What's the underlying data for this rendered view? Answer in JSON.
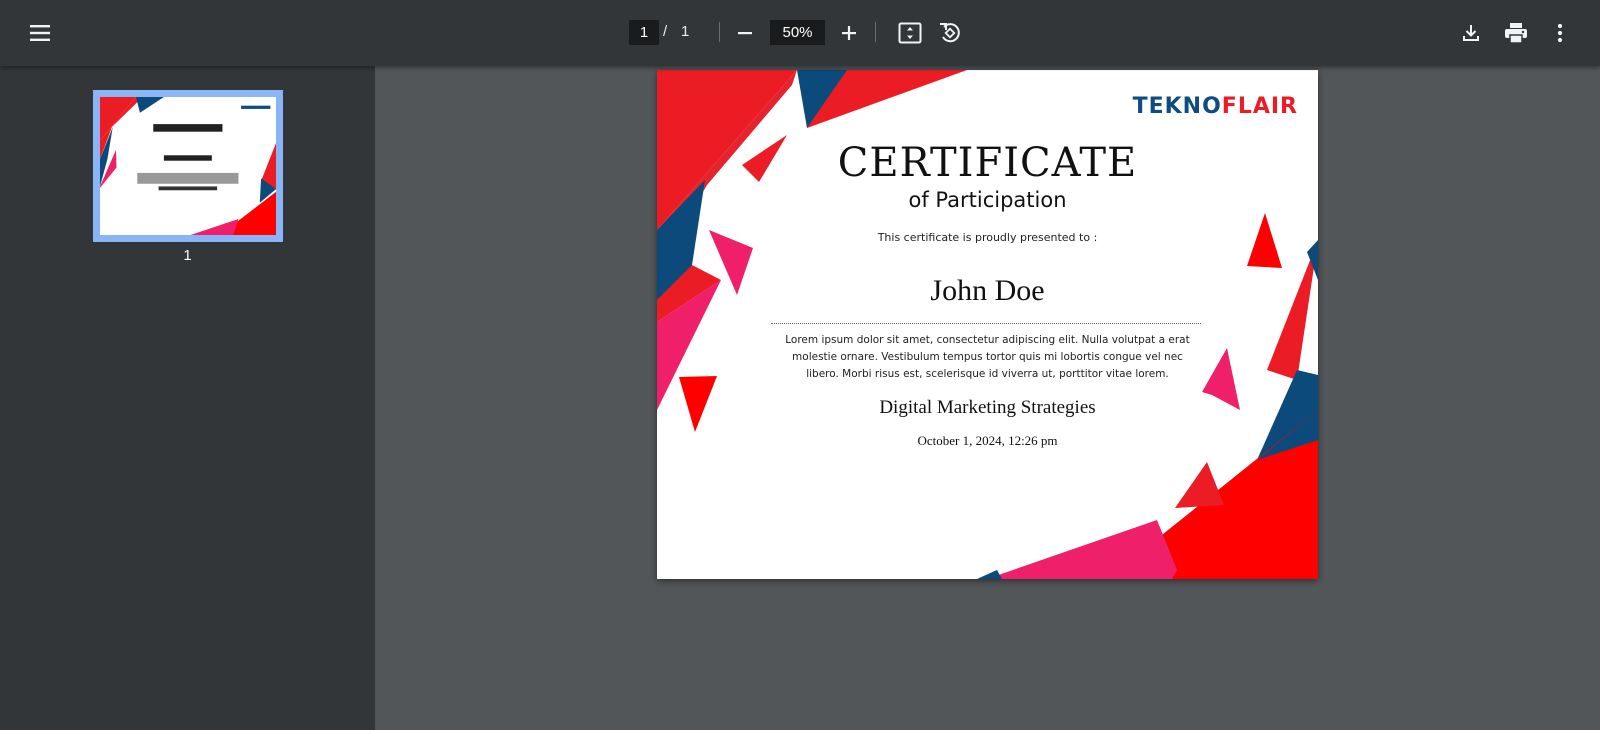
{
  "toolbar": {
    "current_page": "1",
    "page_separator": "/",
    "total_pages": "1",
    "zoom": "50%"
  },
  "icons": [
    "menu-icon",
    "zoom-out-icon",
    "zoom-in-icon",
    "fit-page-icon",
    "rotate-icon",
    "download-icon",
    "print-icon",
    "more-vert-icon"
  ],
  "sidebar": {
    "thumbnails": [
      {
        "page_label": "1"
      }
    ]
  },
  "certificate": {
    "logo_part1": "TEKNO",
    "logo_part2": "FLAIR",
    "title": "CERTIFICATE",
    "subtitle": "of Participation",
    "presented_to": "This certificate is proudly presented to :",
    "recipient": "John Doe",
    "body": "Lorem ipsum dolor sit amet, consectetur adipiscing elit. Nulla volutpat a erat molestie ornare. Vestibulum tempus tortor quis mi lobortis congue vel nec libero. Morbi risus est, scelerisque id viverra ut, porttitor vitae lorem.",
    "course": "Digital Marketing Strategies",
    "date": "October 1, 2024, 12:26 pm"
  },
  "colors": {
    "toolbar_bg": "#323639",
    "viewer_bg": "#525659",
    "thumb_selected": "#8ab4f8",
    "brand_blue": "#0f4c81",
    "brand_red": "#ec1c24",
    "accent_pink": "#f01f6a",
    "accent_navy": "#0b4a7a"
  }
}
